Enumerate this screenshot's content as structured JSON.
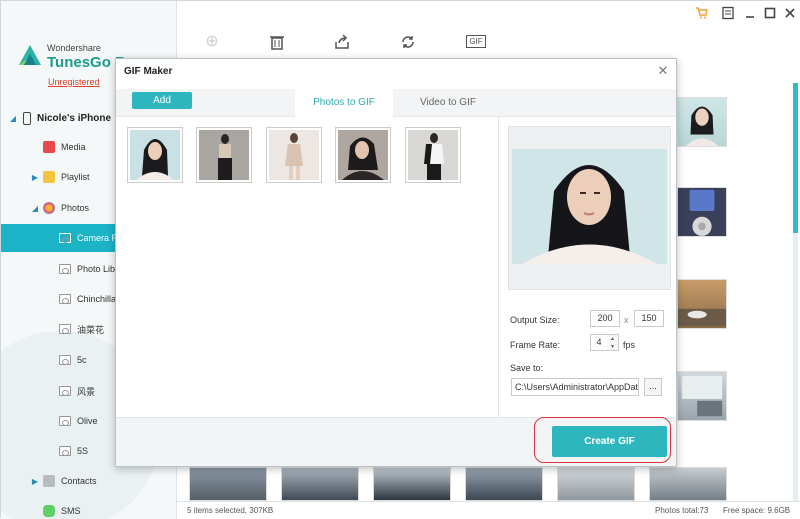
{
  "sidebar": {
    "brand_company": "Wondershare",
    "brand_product": "TunesGo Re",
    "unregistered": "Unregistered",
    "device_name": "Nicole's iPhone",
    "items": [
      {
        "label": "Media"
      },
      {
        "label": "Playlist"
      },
      {
        "label": "Photos"
      },
      {
        "label": "Camera R"
      },
      {
        "label": "Photo Libr"
      },
      {
        "label": "Chinchillas"
      },
      {
        "label": "油菜花"
      },
      {
        "label": "5c"
      },
      {
        "label": "风景"
      },
      {
        "label": "Olive"
      },
      {
        "label": "5S"
      },
      {
        "label": "Contacts"
      },
      {
        "label": "SMS"
      }
    ]
  },
  "toolbar": {
    "gif_label": "GIF"
  },
  "status": {
    "selected": "5 items selected, 307KB",
    "total": "Photos total:73",
    "free": "Free space: 9.6GB"
  },
  "dialog": {
    "title": "GIF Maker",
    "add_label": "Add",
    "tabs": [
      {
        "label": "Photos to GIF"
      },
      {
        "label": "Video to GIF"
      }
    ],
    "output_size_label": "Output Size:",
    "width": "200",
    "x_sep": "x",
    "height": "150",
    "frame_rate_label": "Frame Rate:",
    "frame_rate": "4",
    "fps": "fps",
    "save_to_label": "Save to:",
    "save_path": "C:\\Users\\Administrator\\AppData\\",
    "browse_label": "...",
    "create_label": "Create GIF"
  },
  "colors": {
    "accent": "#2eb6bf",
    "active_nav": "#1bb3c6",
    "highlight_ring": "#d9333f",
    "unregistered": "#e0402d"
  }
}
